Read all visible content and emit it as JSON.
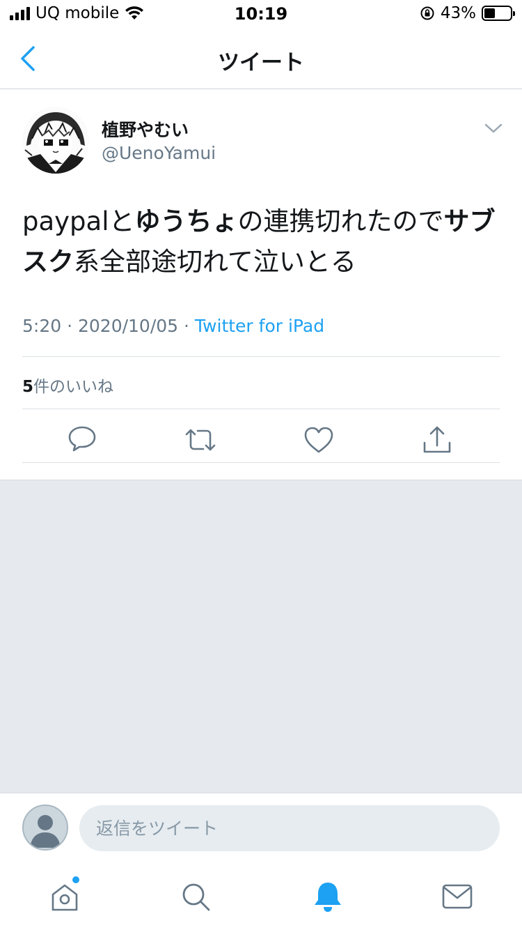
{
  "status_bar": {
    "carrier": "UQ mobile",
    "time": "10:19",
    "battery": "43%",
    "battery_level": 0.43
  },
  "nav": {
    "title": "ツイート"
  },
  "tweet": {
    "display_name": "植野やむい",
    "handle": "@UenoYamui",
    "text_parts": [
      "paypalと",
      "ゆうちょ",
      "の連携切れたので",
      "サブスク",
      "系全部途切れて泣いとる"
    ],
    "time": "5:20",
    "date": "2020/10/05",
    "source": "Twitter for iPad",
    "likes_count": "5",
    "likes_label": "件のいいね"
  },
  "reply": {
    "placeholder": "返信をツイート"
  },
  "tabs": [
    "home-icon",
    "search-icon",
    "notifications-icon",
    "messages-icon"
  ],
  "colors": {
    "accent": "#1da1f2",
    "secondary_text": "#657786",
    "background_gray": "#e6e9ed"
  }
}
